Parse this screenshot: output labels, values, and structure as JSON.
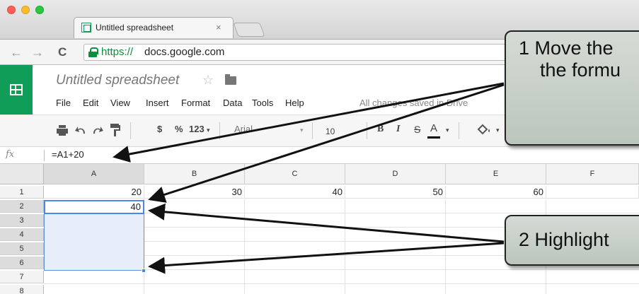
{
  "browser": {
    "tab_title": "Untitled spreadsheet",
    "tab_close": "×",
    "url_scheme": "https://",
    "url_host": "docs.google.com",
    "nav_back": "←",
    "nav_forward": "→",
    "nav_reload": "C"
  },
  "doc": {
    "title": "Untitled spreadsheet",
    "star": "☆",
    "menus": [
      "File",
      "Edit",
      "View",
      "Insert",
      "Format",
      "Data",
      "Tools",
      "Help"
    ],
    "save_status": "All changes saved in Drive"
  },
  "toolbar": {
    "dollar": "$",
    "percent": "%",
    "number_fmt": "123",
    "font": "Arial",
    "font_size": "10",
    "bold": "B",
    "italic": "I",
    "strike": "S",
    "text_color": "A"
  },
  "formula_bar": {
    "fx": "fx",
    "value": "=A1+20"
  },
  "grid": {
    "columns": [
      "A",
      "B",
      "C",
      "D",
      "E",
      "F"
    ],
    "rows": [
      "1",
      "2",
      "3",
      "4",
      "5",
      "6",
      "7",
      "8"
    ],
    "row1": [
      "20",
      "30",
      "40",
      "50",
      "60",
      ""
    ],
    "row2_a": "40"
  },
  "callouts": {
    "one_line1": "1  Move the",
    "one_line2": "    the formu",
    "two": "2  Highlight"
  },
  "colors": {
    "sheets_green": "#0f9d58",
    "selection_blue": "#4a86e8",
    "callout_fill": "#c8d0c8"
  }
}
